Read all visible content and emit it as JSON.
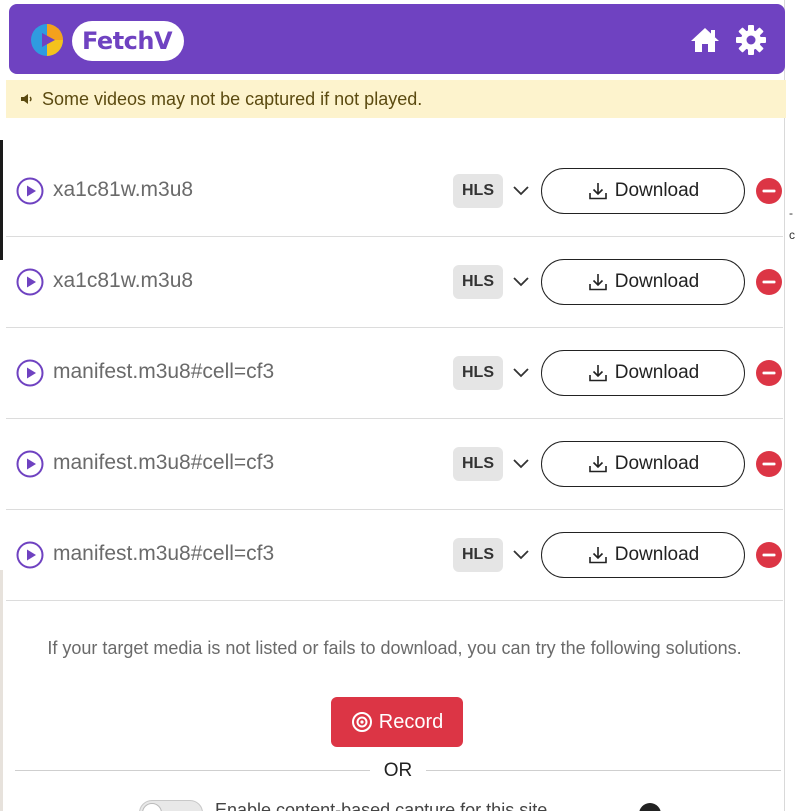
{
  "header": {
    "logo_text": "FetchV",
    "home_icon": "home-icon",
    "settings_icon": "gear-icon",
    "brand_color": "#6f42c1"
  },
  "notice": {
    "icon": "speaker-icon",
    "text": "Some videos may not be captured if not played."
  },
  "media": [
    {
      "name": "xa1c81w.m3u8",
      "format": "HLS",
      "download_label": "Download"
    },
    {
      "name": "xa1c81w.m3u8",
      "format": "HLS",
      "download_label": "Download"
    },
    {
      "name": "manifest.m3u8#cell=cf3",
      "format": "HLS",
      "download_label": "Download"
    },
    {
      "name": "manifest.m3u8#cell=cf3",
      "format": "HLS",
      "download_label": "Download"
    },
    {
      "name": "manifest.m3u8#cell=cf3",
      "format": "HLS",
      "download_label": "Download"
    }
  ],
  "footer": {
    "help_text": "If your target media is not listed or fails to download, you can try the following solutions.",
    "record_label": "Record",
    "or_text": "OR",
    "toggle_label": "Enable content-based capture for this site"
  },
  "colors": {
    "accent": "#6f42c1",
    "danger": "#dc3545",
    "notice_bg": "#fdf3cd"
  }
}
